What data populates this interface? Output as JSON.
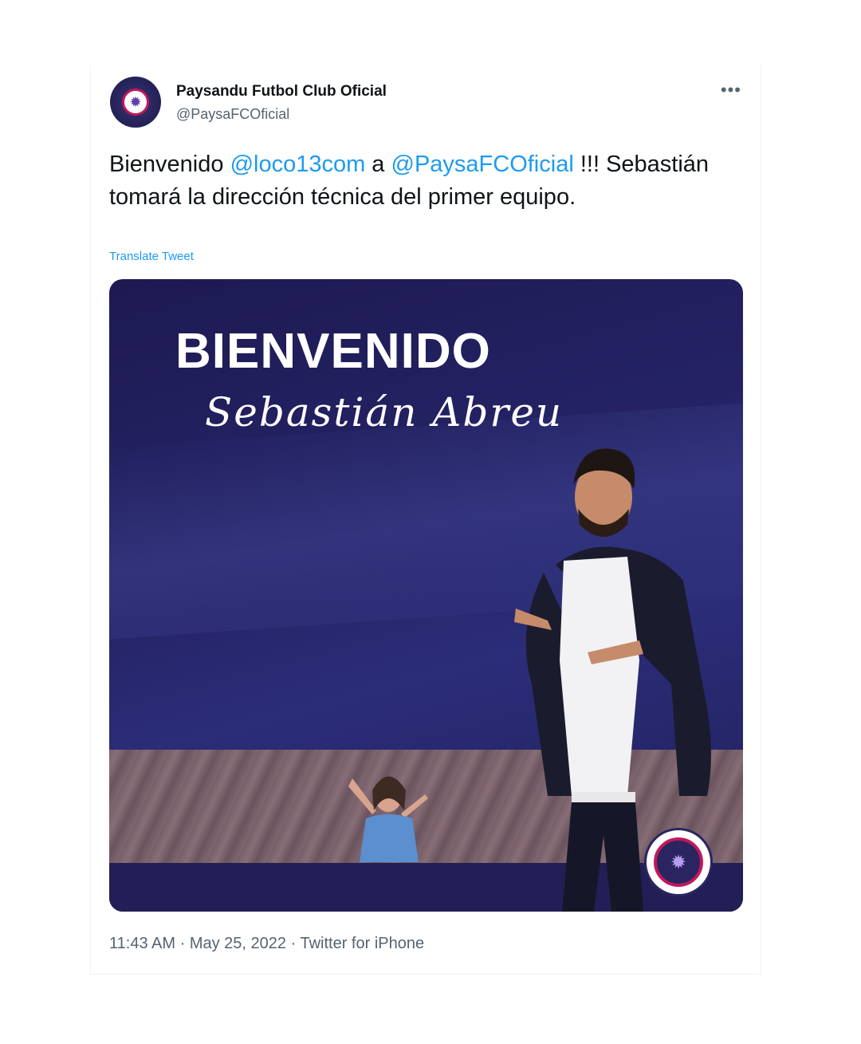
{
  "tweet": {
    "author_name": "Paysandu Futbol Club Oficial",
    "author_handle": "@PaysaFCOficial",
    "more_icon": "more-horizontal-icon",
    "text_part1": "Bienvenido ",
    "mention1": "@loco13com",
    "text_part2": " a ",
    "mention2": "@PaysaFCOficial",
    "text_part3": " !!! Sebastián tomará la dirección técnica del primer equipo.",
    "translate_label": "Translate Tweet",
    "time": "11:43 AM",
    "separator": "·",
    "date": "May 25, 2022",
    "source": "Twitter for iPhone"
  },
  "media": {
    "headline": "BIENVENIDO",
    "script_name": "Sebastián Abreu"
  },
  "colors": {
    "link": "#1d9bf0",
    "secondary_text": "#536471",
    "media_background": "#1d1a52",
    "club_accent": "#c2185b"
  }
}
